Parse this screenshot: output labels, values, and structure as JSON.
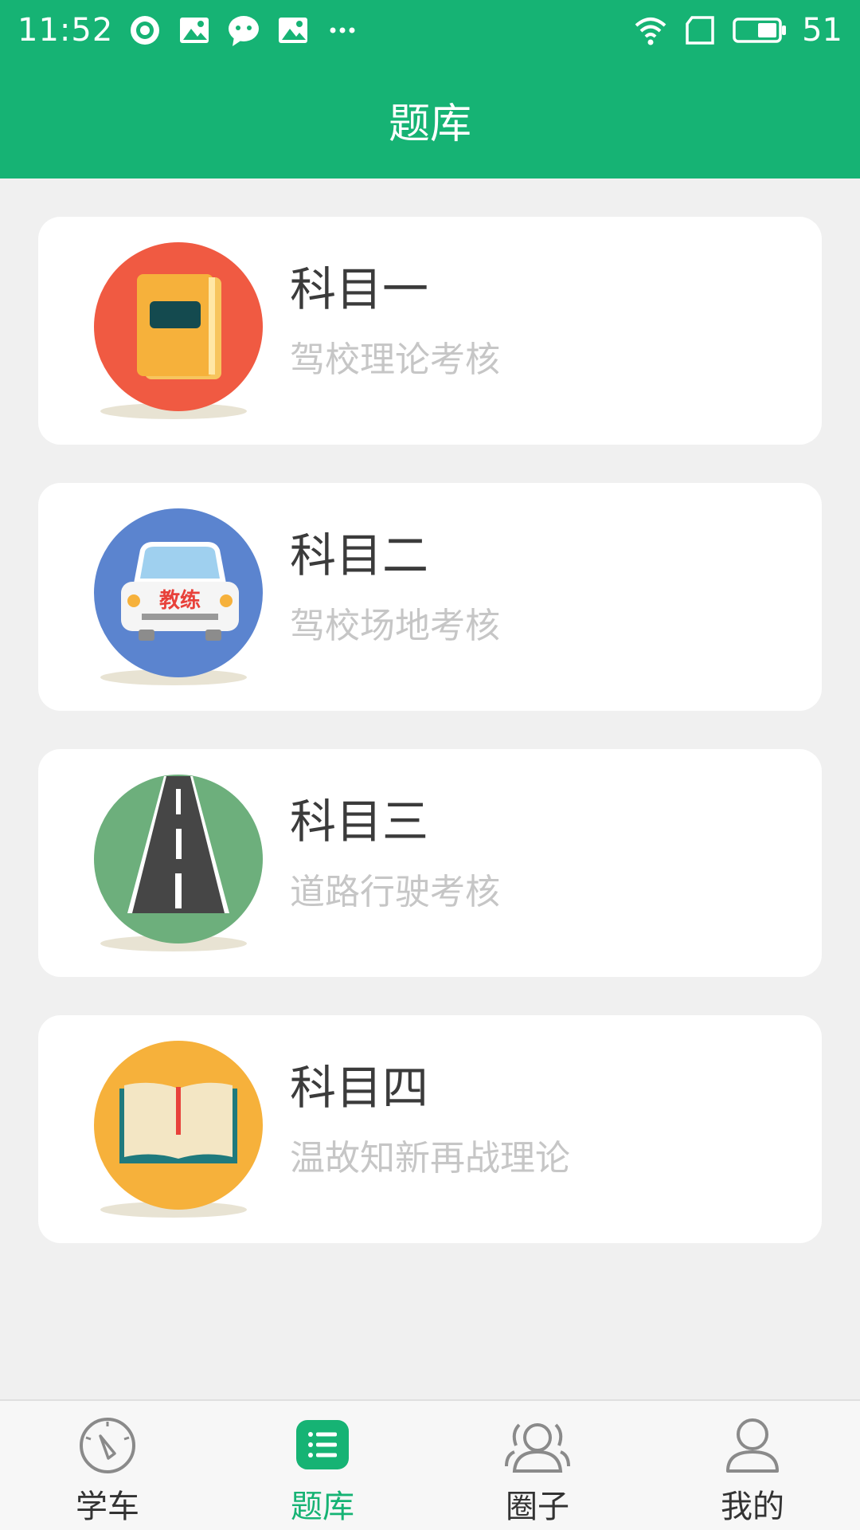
{
  "status_bar": {
    "time": "11:52",
    "battery": "51",
    "icons": [
      "record-icon",
      "image-icon",
      "chat-icon",
      "image-icon",
      "more-icon",
      "wifi-icon",
      "sim-icon",
      "battery-icon"
    ]
  },
  "header": {
    "title": "题库"
  },
  "subjects": [
    {
      "title": "科目一",
      "subtitle": "驾校理论考核",
      "icon": "closed-book-icon",
      "color": "#f05a42"
    },
    {
      "title": "科目二",
      "subtitle": "驾校场地考核",
      "icon": "training-car-icon",
      "color": "#5b84cf",
      "badge": "教练"
    },
    {
      "title": "科目三",
      "subtitle": "道路行驶考核",
      "icon": "road-icon",
      "color": "#6daf7c"
    },
    {
      "title": "科目四",
      "subtitle": "温故知新再战理论",
      "icon": "open-book-icon",
      "color": "#f6b13b"
    }
  ],
  "bottom_nav": {
    "items": [
      {
        "label": "学车",
        "icon": "speedometer-icon",
        "active": false
      },
      {
        "label": "题库",
        "icon": "list-icon",
        "active": true
      },
      {
        "label": "圈子",
        "icon": "community-icon",
        "active": false
      },
      {
        "label": "我的",
        "icon": "profile-icon",
        "active": false
      }
    ]
  },
  "colors": {
    "brand": "#16b374",
    "background": "#f0f0f0",
    "title_text": "#3b3b3b",
    "subtitle_text": "#c6c6c6"
  }
}
